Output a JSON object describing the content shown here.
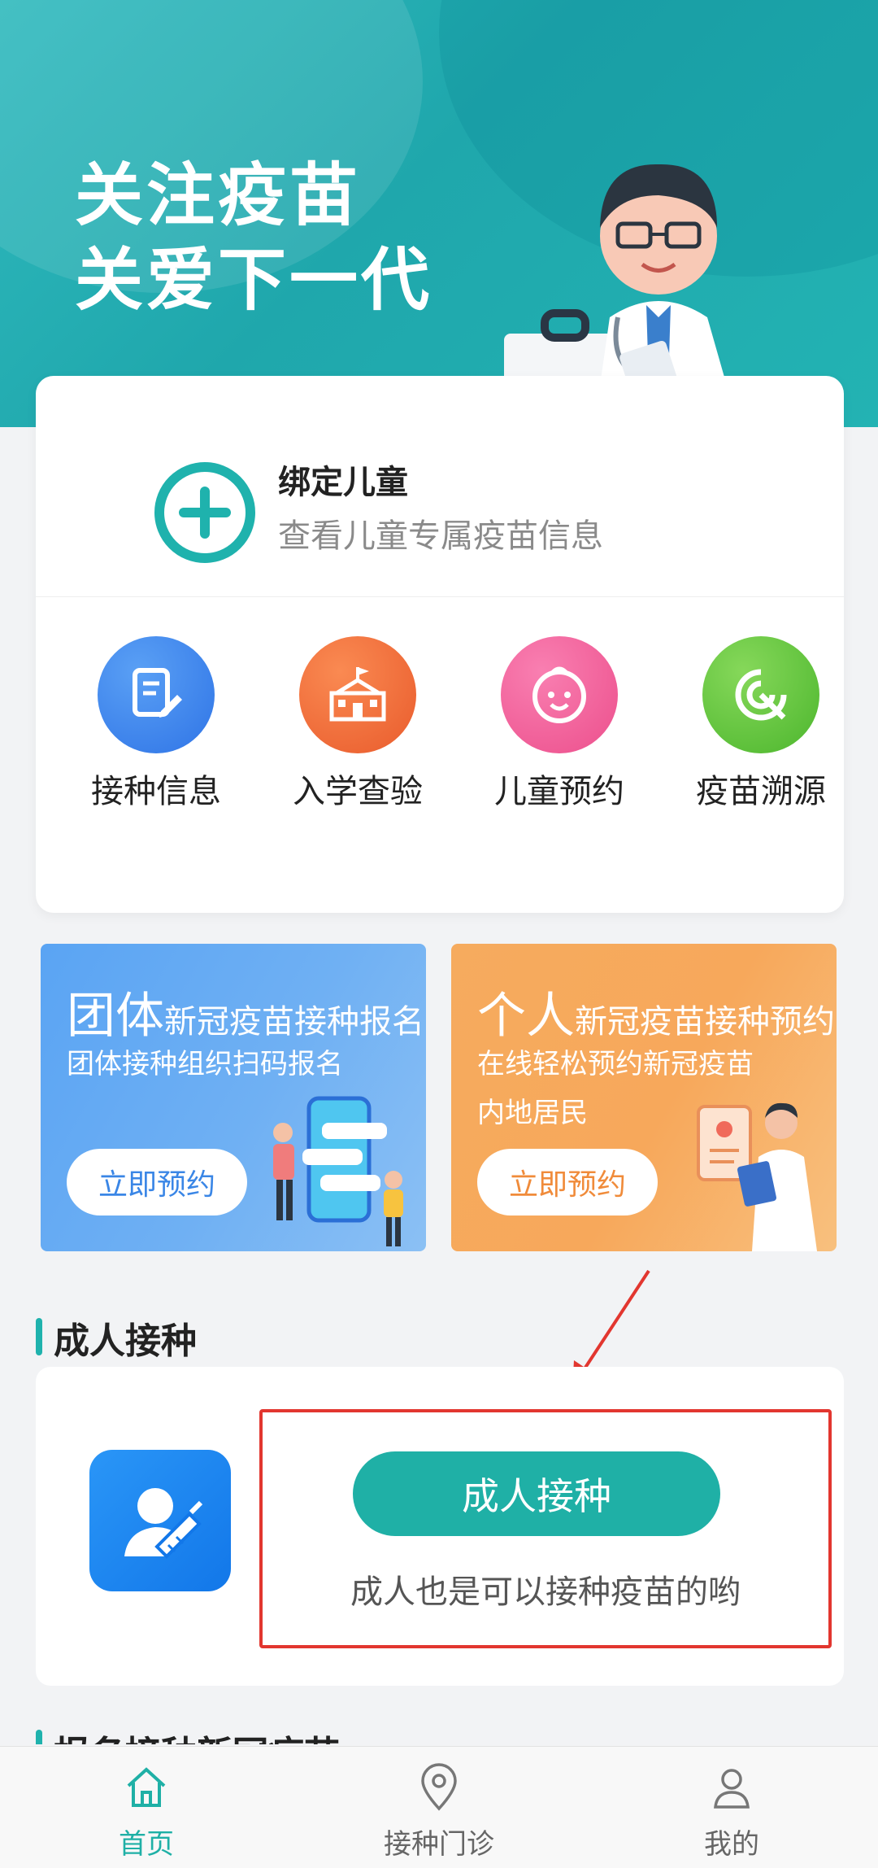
{
  "banner": {
    "title_line1": "关注疫苗",
    "title_line2": "关爱下一代"
  },
  "bind_child": {
    "title": "绑定儿童",
    "subtitle": "查看儿童专属疫苗信息"
  },
  "quick_actions": [
    {
      "label": "接种信息",
      "icon": "document-edit-icon",
      "color": "#3f86ee"
    },
    {
      "label": "入学查验",
      "icon": "school-icon",
      "color": "#f0683a"
    },
    {
      "label": "儿童预约",
      "icon": "baby-face-icon",
      "color": "#f2609a"
    },
    {
      "label": "疫苗溯源",
      "icon": "trace-icon",
      "color": "#62c63d"
    }
  ],
  "promo_group": {
    "title_big": "团体",
    "title_small": "新冠疫苗接种报名",
    "line1": "团体接种组织扫码报名",
    "button": "立即预约"
  },
  "promo_personal": {
    "title_big": "个人",
    "title_small": "新冠疫苗接种预约",
    "line1": "在线轻松预约新冠疫苗",
    "line2": "内地居民",
    "button": "立即预约"
  },
  "adult_section": {
    "title": "成人接种",
    "button": "成人接种",
    "description": "成人也是可以接种疫苗的哟"
  },
  "next_section_title": "报名接种新冠疫苗",
  "tabbar": [
    {
      "label": "首页",
      "icon": "home-icon",
      "active": true
    },
    {
      "label": "接种门诊",
      "icon": "location-pin-icon",
      "active": false
    },
    {
      "label": "我的",
      "icon": "user-icon",
      "active": false
    }
  ],
  "colors": {
    "accent": "#1fb0a6",
    "highlight_red": "#e2362f"
  }
}
